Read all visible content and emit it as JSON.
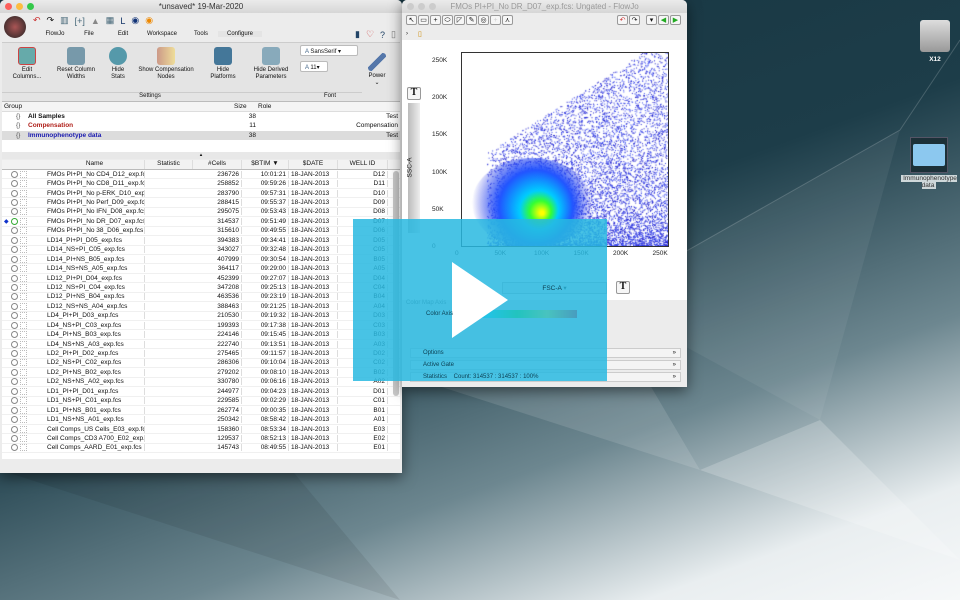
{
  "main_window": {
    "title": "*unsaved* 19-Mar-2020",
    "menu": [
      "FlowJo",
      "File",
      "Edit",
      "Workspace",
      "Tools",
      "Configure"
    ],
    "ribbon": [
      {
        "label": "Edit Columns...",
        "icon": "edit-columns-icon"
      },
      {
        "label": "Reset Column Widths",
        "icon": "reset-columns-icon"
      },
      {
        "label": "Hide Stats",
        "icon": "sigma-icon"
      },
      {
        "label": "Show Compensation Nodes",
        "icon": "compensation-icon"
      },
      {
        "label": "Hide Platforms",
        "icon": "platforms-icon"
      },
      {
        "label": "Hide Derived Parameters",
        "icon": "derived-icon"
      }
    ],
    "settings_label": "Settings",
    "font_label": "Font",
    "font_family": "SansSerif",
    "font_size": "11",
    "power_label": "Power",
    "groups_header": {
      "group": "Group",
      "size": "Size",
      "role": "Role"
    },
    "groups": [
      {
        "name": "All Samples",
        "size": "38",
        "role": "Test",
        "color": "#111111"
      },
      {
        "name": "Compensation",
        "size": "11",
        "role": "Compensation",
        "color": "#b0201a"
      },
      {
        "name": "Immunophenotype data",
        "size": "38",
        "role": "Test",
        "color": "#1a1ab0"
      }
    ],
    "columns": [
      "Name",
      "Statistic",
      "#Cells",
      "$BTIM",
      "$DATE",
      "WELL ID"
    ],
    "samples": [
      [
        "FMOs PI+PI_No CD4_D12_exp.fcs",
        "236726",
        "10:01:21",
        "18-JAN-2013",
        "D12"
      ],
      [
        "FMOs PI+PI_No CD8_D11_exp.fcs",
        "258852",
        "09:59:26",
        "18-JAN-2013",
        "D11"
      ],
      [
        "FMOs PI+PI_No p-ERK_D10_exp.fcs",
        "283790",
        "09:57:31",
        "18-JAN-2013",
        "D10"
      ],
      [
        "FMOs PI+PI_No Perf_D09_exp.fcs",
        "288415",
        "09:55:37",
        "18-JAN-2013",
        "D09"
      ],
      [
        "FMOs PI+PI_No IFN_D08_exp.fcs",
        "295075",
        "09:53:43",
        "18-JAN-2013",
        "D08"
      ],
      [
        "FMOs PI+PI_No DR_D07_exp.fcs",
        "314537",
        "09:51:49",
        "18-JAN-2013",
        "D07"
      ],
      [
        "FMOs PI+PI_No 38_D06_exp.fcs",
        "315610",
        "09:49:55",
        "18-JAN-2013",
        "D06"
      ],
      [
        "LD14_PI+PI_D05_exp.fcs",
        "394383",
        "09:34:41",
        "18-JAN-2013",
        "D05"
      ],
      [
        "LD14_NS+PI_C05_exp.fcs",
        "343027",
        "09:32:48",
        "18-JAN-2013",
        "C05"
      ],
      [
        "LD14_PI+NS_B05_exp.fcs",
        "407999",
        "09:30:54",
        "18-JAN-2013",
        "B05"
      ],
      [
        "LD14_NS+NS_A05_exp.fcs",
        "364117",
        "09:29:00",
        "18-JAN-2013",
        "A05"
      ],
      [
        "LD12_PI+PI_D04_exp.fcs",
        "452399",
        "09:27:07",
        "18-JAN-2013",
        "D04"
      ],
      [
        "LD12_NS+PI_C04_exp.fcs",
        "347208",
        "09:25:13",
        "18-JAN-2013",
        "C04"
      ],
      [
        "LD12_PI+NS_B04_exp.fcs",
        "463536",
        "09:23:19",
        "18-JAN-2013",
        "B04"
      ],
      [
        "LD12_NS+NS_A04_exp.fcs",
        "388463",
        "09:21:25",
        "18-JAN-2013",
        "A04"
      ],
      [
        "LD4_PI+PI_D03_exp.fcs",
        "210530",
        "09:19:32",
        "18-JAN-2013",
        "D03"
      ],
      [
        "LD4_NS+PI_C03_exp.fcs",
        "199393",
        "09:17:38",
        "18-JAN-2013",
        "C03"
      ],
      [
        "LD4_PI+NS_B03_exp.fcs",
        "224146",
        "09:15:45",
        "18-JAN-2013",
        "B03"
      ],
      [
        "LD4_NS+NS_A03_exp.fcs",
        "222740",
        "09:13:51",
        "18-JAN-2013",
        "A03"
      ],
      [
        "LD2_PI+PI_D02_exp.fcs",
        "275465",
        "09:11:57",
        "18-JAN-2013",
        "D02"
      ],
      [
        "LD2_NS+PI_C02_exp.fcs",
        "286306",
        "09:10:04",
        "18-JAN-2013",
        "C02"
      ],
      [
        "LD2_PI+NS_B02_exp.fcs",
        "279202",
        "09:08:10",
        "18-JAN-2013",
        "B02"
      ],
      [
        "LD2_NS+NS_A02_exp.fcs",
        "330780",
        "09:06:16",
        "18-JAN-2013",
        "A02"
      ],
      [
        "LD1_PI+PI_D01_exp.fcs",
        "244977",
        "09:04:23",
        "18-JAN-2013",
        "D01"
      ],
      [
        "LD1_NS+PI_C01_exp.fcs",
        "229585",
        "09:02:29",
        "18-JAN-2013",
        "C01"
      ],
      [
        "LD1_PI+NS_B01_exp.fcs",
        "262774",
        "09:00:35",
        "18-JAN-2013",
        "B01"
      ],
      [
        "LD1_NS+NS_A01_exp.fcs",
        "250342",
        "08:58:42",
        "18-JAN-2013",
        "A01"
      ],
      [
        "Cell Comps_US Cells_E03_exp.fcs",
        "158360",
        "08:53:34",
        "18-JAN-2013",
        "E03"
      ],
      [
        "Cell Comps_CD3 A700_E02_exp.fcs",
        "129537",
        "08:52:13",
        "18-JAN-2013",
        "E02"
      ],
      [
        "Cell Comps_AARD_E01_exp.fcs",
        "145743",
        "08:49:55",
        "18-JAN-2013",
        "E01"
      ]
    ]
  },
  "plot_window": {
    "title": "FMOs PI+PI_No DR_D07_exp.fcs: Ungated - FlowJo",
    "y_axis": "SSC-A",
    "x_axis": "FSC-A",
    "y_ticks": [
      "250K",
      "200K",
      "150K",
      "100K",
      "50K",
      "0"
    ],
    "x_ticks": [
      "0",
      "50K",
      "100K",
      "150K",
      "200K",
      "250K"
    ],
    "color_map_label": "Color Map Axis",
    "color_axis_label": "Color Axis",
    "panels": [
      "Options",
      "Active Gate",
      "Statistics    Count: 314537 : 314537 : 100%"
    ]
  },
  "desktop": {
    "drive_label": "X12",
    "folder_label": "Immunophenotype data"
  },
  "colors": {
    "overlay": "#28b9e1",
    "selected_row": "#dcdcdc"
  }
}
